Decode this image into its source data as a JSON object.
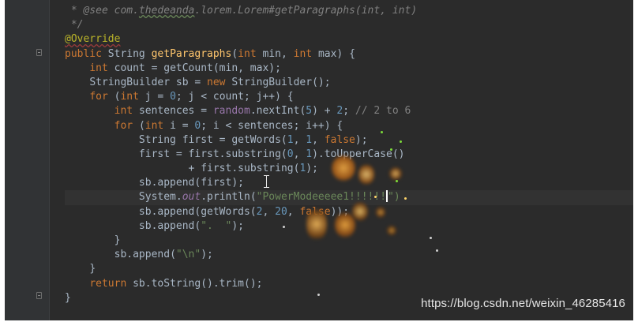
{
  "editor": {
    "lines": [
      {
        "indent": "",
        "tokens": [
          {
            "t": " * @see ",
            "c": "tok-comment"
          },
          {
            "t": "com.",
            "c": "tok-comment"
          },
          {
            "t": "thedeanda",
            "c": "tok-comment tok-underline"
          },
          {
            "t": ".lorem.Lorem#getParagraphs(int, int)",
            "c": "tok-comment"
          }
        ]
      },
      {
        "indent": "",
        "tokens": [
          {
            "t": " */",
            "c": "tok-comment"
          }
        ]
      },
      {
        "indent": "",
        "tokens": [
          {
            "t": "@Override",
            "c": "tok-anno tok-anno-u"
          }
        ]
      },
      {
        "indent": "",
        "tokens": [
          {
            "t": "public ",
            "c": "tok-kw"
          },
          {
            "t": "String ",
            "c": ""
          },
          {
            "t": "getParagraphs",
            "c": "tok-fn"
          },
          {
            "t": "(",
            "c": ""
          },
          {
            "t": "int ",
            "c": "tok-kw"
          },
          {
            "t": "min, ",
            "c": ""
          },
          {
            "t": "int ",
            "c": "tok-kw"
          },
          {
            "t": "max) {",
            "c": ""
          }
        ]
      },
      {
        "indent": "    ",
        "tokens": [
          {
            "t": "int ",
            "c": "tok-kw"
          },
          {
            "t": "count = getCount(min, max);",
            "c": ""
          }
        ]
      },
      {
        "indent": "    ",
        "tokens": [
          {
            "t": "StringBuilder sb = ",
            "c": ""
          },
          {
            "t": "new ",
            "c": "tok-kw"
          },
          {
            "t": "StringBuilder();",
            "c": ""
          }
        ]
      },
      {
        "indent": "    ",
        "tokens": [
          {
            "t": "for ",
            "c": "tok-kw"
          },
          {
            "t": "(",
            "c": ""
          },
          {
            "t": "int ",
            "c": "tok-kw"
          },
          {
            "t": "j = ",
            "c": ""
          },
          {
            "t": "0",
            "c": "tok-num"
          },
          {
            "t": "; j < count; j++) {",
            "c": ""
          }
        ]
      },
      {
        "indent": "        ",
        "tokens": [
          {
            "t": "int ",
            "c": "tok-kw"
          },
          {
            "t": "sentences = ",
            "c": ""
          },
          {
            "t": "random",
            "c": "tok-field"
          },
          {
            "t": ".nextInt(",
            "c": ""
          },
          {
            "t": "5",
            "c": "tok-num"
          },
          {
            "t": ") + ",
            "c": ""
          },
          {
            "t": "2",
            "c": "tok-num"
          },
          {
            "t": "; ",
            "c": ""
          },
          {
            "t": "// 2 to 6",
            "c": "tok-lc"
          }
        ]
      },
      {
        "indent": "        ",
        "tokens": [
          {
            "t": "for ",
            "c": "tok-kw"
          },
          {
            "t": "(",
            "c": ""
          },
          {
            "t": "int ",
            "c": "tok-kw"
          },
          {
            "t": "i = ",
            "c": ""
          },
          {
            "t": "0",
            "c": "tok-num"
          },
          {
            "t": "; i < sentences; i++) {",
            "c": ""
          }
        ]
      },
      {
        "indent": "            ",
        "tokens": [
          {
            "t": "String first = getWords(",
            "c": ""
          },
          {
            "t": "1",
            "c": "tok-num"
          },
          {
            "t": ", ",
            "c": ""
          },
          {
            "t": "1",
            "c": "tok-num"
          },
          {
            "t": ", ",
            "c": ""
          },
          {
            "t": "false",
            "c": "tok-kw"
          },
          {
            "t": ");",
            "c": ""
          }
        ]
      },
      {
        "indent": "            ",
        "tokens": [
          {
            "t": "first = first.substring(",
            "c": ""
          },
          {
            "t": "0",
            "c": "tok-num"
          },
          {
            "t": ", ",
            "c": ""
          },
          {
            "t": "1",
            "c": "tok-num"
          },
          {
            "t": ").toUpperCase()",
            "c": ""
          }
        ]
      },
      {
        "indent": "                    ",
        "tokens": [
          {
            "t": "+ first.substring(",
            "c": ""
          },
          {
            "t": "1",
            "c": "tok-num"
          },
          {
            "t": ");",
            "c": ""
          }
        ]
      },
      {
        "indent": "            ",
        "tokens": [
          {
            "t": "sb.append(first);",
            "c": ""
          }
        ]
      },
      {
        "indent": "            ",
        "current": true,
        "caretAfter": 3,
        "tokens": [
          {
            "t": "System.",
            "c": ""
          },
          {
            "t": "out",
            "c": "tok-static"
          },
          {
            "t": ".println(",
            "c": ""
          },
          {
            "t": "\"PowerModeeeee1!!!!!!",
            "c": "tok-str"
          },
          {
            "t": "\")",
            "c": "tok-str"
          }
        ]
      },
      {
        "indent": "            ",
        "tokens": [
          {
            "t": "sb.append(getWords(",
            "c": ""
          },
          {
            "t": "2",
            "c": "tok-num"
          },
          {
            "t": ", ",
            "c": ""
          },
          {
            "t": "20",
            "c": "tok-num"
          },
          {
            "t": ", ",
            "c": ""
          },
          {
            "t": "false",
            "c": "tok-kw"
          },
          {
            "t": "));",
            "c": ""
          }
        ]
      },
      {
        "indent": "            ",
        "tokens": [
          {
            "t": "sb.append(",
            "c": ""
          },
          {
            "t": "\".  \"",
            "c": "tok-str"
          },
          {
            "t": ");",
            "c": ""
          }
        ]
      },
      {
        "indent": "        ",
        "tokens": [
          {
            "t": "}",
            "c": ""
          }
        ]
      },
      {
        "indent": "        ",
        "tokens": [
          {
            "t": "sb.append(",
            "c": ""
          },
          {
            "t": "\"\\n\"",
            "c": "tok-str"
          },
          {
            "t": ");",
            "c": ""
          }
        ]
      },
      {
        "indent": "    ",
        "tokens": [
          {
            "t": "}",
            "c": ""
          }
        ]
      },
      {
        "indent": "    ",
        "tokens": [
          {
            "t": "return ",
            "c": "tok-kw"
          },
          {
            "t": "sb.toString().trim();",
            "c": ""
          }
        ]
      },
      {
        "indent": "",
        "tokens": [
          {
            "t": "}",
            "c": ""
          }
        ]
      }
    ]
  },
  "watermark": "https://blog.csdn.net/weixin_46285416"
}
